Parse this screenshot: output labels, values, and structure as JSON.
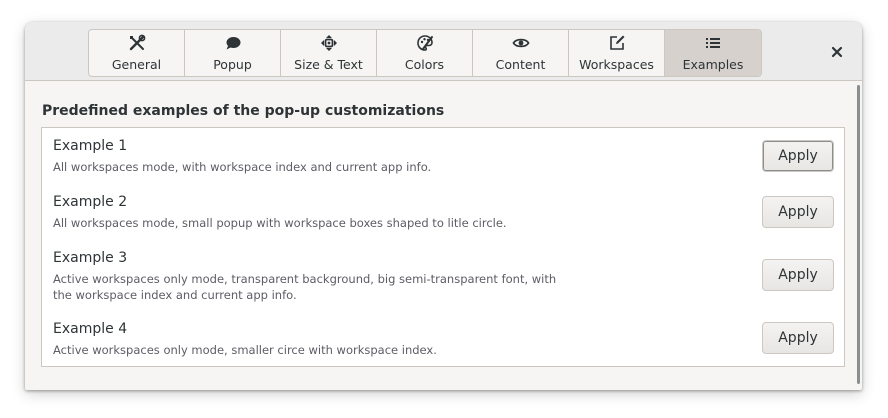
{
  "tabs": [
    {
      "label": "General",
      "icon": "tools-icon",
      "active": false
    },
    {
      "label": "Popup",
      "icon": "speech-bubble-icon",
      "active": false
    },
    {
      "label": "Size & Text",
      "icon": "move-icon",
      "active": false
    },
    {
      "label": "Colors",
      "icon": "palette-icon",
      "active": false
    },
    {
      "label": "Content",
      "icon": "eye-icon",
      "active": false
    },
    {
      "label": "Workspaces",
      "icon": "edit-icon",
      "active": false
    },
    {
      "label": "Examples",
      "icon": "list-icon",
      "active": true
    }
  ],
  "close_icon": "close-icon",
  "section_title": "Predefined examples of the pop-up customizations",
  "examples": [
    {
      "title": "Example 1",
      "description": "All workspaces mode, with workspace index and current app info.",
      "button": "Apply"
    },
    {
      "title": "Example 2",
      "description": "All workspaces mode, small popup with workspace boxes shaped to litle circle.",
      "button": "Apply"
    },
    {
      "title": "Example 3",
      "description": "Active workspaces only mode, transparent background, big semi-transparent font, with the workspace index and current app info.",
      "button": "Apply"
    },
    {
      "title": "Example 4",
      "description": "Active workspaces only mode, smaller circe with workspace index.",
      "button": "Apply"
    }
  ],
  "colors": {
    "text": "#2e3436",
    "secondary_text": "#5e5c64",
    "active_tab": "#d6d1cd",
    "border": "#cdc7c2"
  }
}
